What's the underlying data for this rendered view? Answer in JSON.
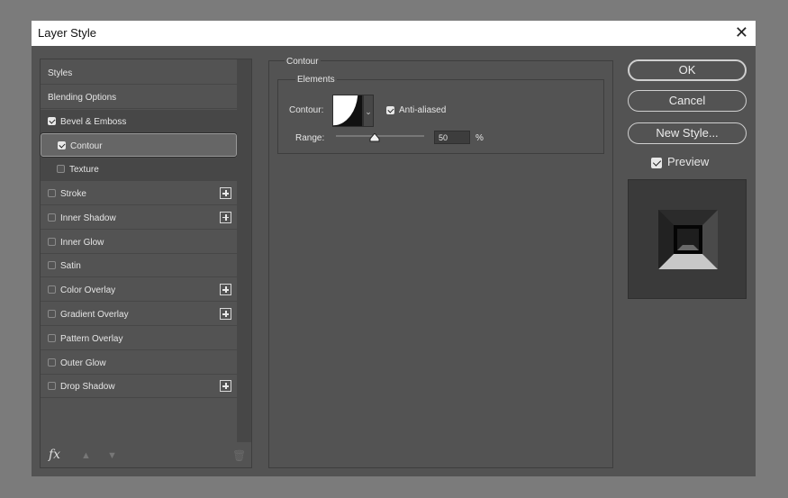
{
  "dialog": {
    "title": "Layer Style",
    "close_glyph": "✕"
  },
  "sidebar": {
    "items": [
      {
        "label": "Styles",
        "checkbox": false,
        "has_plus": false,
        "indent": false
      },
      {
        "label": "Blending Options",
        "checkbox": false,
        "has_plus": false,
        "indent": false
      },
      {
        "label": "Bevel & Emboss",
        "checkbox": true,
        "checked": true,
        "has_plus": false,
        "indent": false
      },
      {
        "label": "Contour",
        "checkbox": true,
        "checked": true,
        "has_plus": false,
        "indent": true,
        "selected": true
      },
      {
        "label": "Texture",
        "checkbox": true,
        "checked": false,
        "has_plus": false,
        "indent": true
      },
      {
        "label": "Stroke",
        "checkbox": true,
        "checked": false,
        "has_plus": true,
        "indent": false
      },
      {
        "label": "Inner Shadow",
        "checkbox": true,
        "checked": false,
        "has_plus": true,
        "indent": false
      },
      {
        "label": "Inner Glow",
        "checkbox": true,
        "checked": false,
        "has_plus": false,
        "indent": false
      },
      {
        "label": "Satin",
        "checkbox": true,
        "checked": false,
        "has_plus": false,
        "indent": false
      },
      {
        "label": "Color Overlay",
        "checkbox": true,
        "checked": false,
        "has_plus": true,
        "indent": false
      },
      {
        "label": "Gradient Overlay",
        "checkbox": true,
        "checked": false,
        "has_plus": true,
        "indent": false
      },
      {
        "label": "Pattern Overlay",
        "checkbox": true,
        "checked": false,
        "has_plus": false,
        "indent": false
      },
      {
        "label": "Outer Glow",
        "checkbox": true,
        "checked": false,
        "has_plus": false,
        "indent": false
      },
      {
        "label": "Drop Shadow",
        "checkbox": true,
        "checked": false,
        "has_plus": true,
        "indent": false
      }
    ],
    "footer": {
      "fx_label": "fx",
      "up_icon": "arrow-up-icon",
      "down_icon": "arrow-down-icon",
      "trash_icon": "trash-icon"
    }
  },
  "contour_panel": {
    "section_title": "Contour",
    "group_title": "Elements",
    "contour_label": "Contour:",
    "anti_aliased_label": "Anti-aliased",
    "anti_aliased_checked": true,
    "range_label": "Range:",
    "range_value": "50",
    "range_unit": "%",
    "range_percent": 50
  },
  "buttons": {
    "ok": "OK",
    "cancel": "Cancel",
    "new_style": "New Style..."
  },
  "preview": {
    "label": "Preview",
    "checked": true
  }
}
